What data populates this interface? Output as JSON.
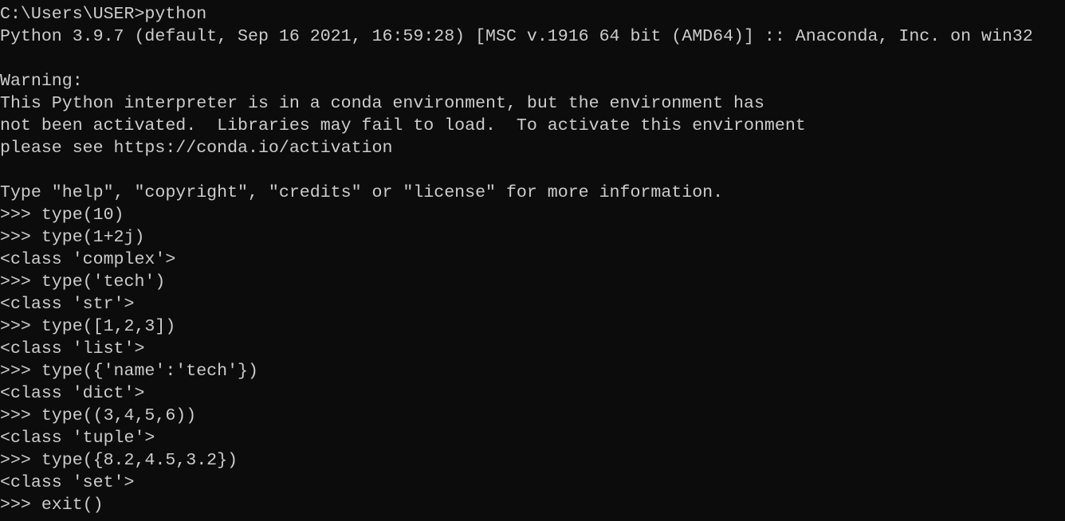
{
  "terminal": {
    "background": "#0c0c0c",
    "foreground": "#cccccc",
    "lines": [
      "C:\\Users\\USER>python",
      "Python 3.9.7 (default, Sep 16 2021, 16:59:28) [MSC v.1916 64 bit (AMD64)] :: Anaconda, Inc. on win32",
      "",
      "Warning:",
      "This Python interpreter is in a conda environment, but the environment has",
      "not been activated.  Libraries may fail to load.  To activate this environment",
      "please see https://conda.io/activation",
      "",
      "Type \"help\", \"copyright\", \"credits\" or \"license\" for more information.",
      ">>> type(10)",
      ">>> type(1+2j)",
      "<class 'complex'>",
      ">>> type('tech')",
      "<class 'str'>",
      ">>> type([1,2,3])",
      "<class 'list'>",
      ">>> type({'name':'tech'})",
      "<class 'dict'>",
      ">>> type((3,4,5,6))",
      "<class 'tuple'>",
      ">>> type({8.2,4.5,3.2})",
      "<class 'set'>",
      ">>> exit()"
    ]
  }
}
